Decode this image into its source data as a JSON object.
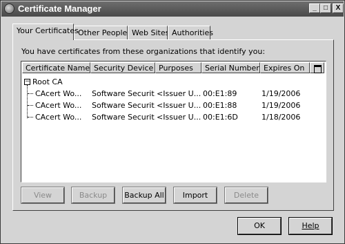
{
  "window": {
    "title": "Certificate Manager",
    "controls": {
      "minimize": "_",
      "maximize": "□",
      "close": "X"
    }
  },
  "tabs": [
    {
      "label": "Your Certificates",
      "active": true
    },
    {
      "label": "Other People's",
      "active": false
    },
    {
      "label": "Web Sites",
      "active": false
    },
    {
      "label": "Authorities",
      "active": false
    }
  ],
  "panel": {
    "intro": "You have certificates from these organizations that identify you:"
  },
  "table": {
    "columns": [
      "Certificate Name",
      "Security Device",
      "Purposes",
      "Serial Number",
      "Expires On"
    ],
    "group": {
      "expander": "−",
      "label": "Root CA"
    },
    "rows": [
      [
        "CAcert Wo...",
        "Software Securit...",
        "<Issuer U...",
        "00:E1:89",
        "1/19/2006"
      ],
      [
        "CAcert Wo...",
        "Software Securit...",
        "<Issuer U...",
        "00:E1:88",
        "1/19/2006"
      ],
      [
        "CAcert Wo...",
        "Software Securit...",
        "<Issuer U...",
        "00:E1:6D",
        "1/18/2006"
      ]
    ]
  },
  "actions": {
    "view": "View",
    "backup": "Backup",
    "backup_all": "Backup All",
    "import": "Import",
    "delete": "Delete"
  },
  "dialog": {
    "ok": "OK",
    "help": "Help"
  }
}
